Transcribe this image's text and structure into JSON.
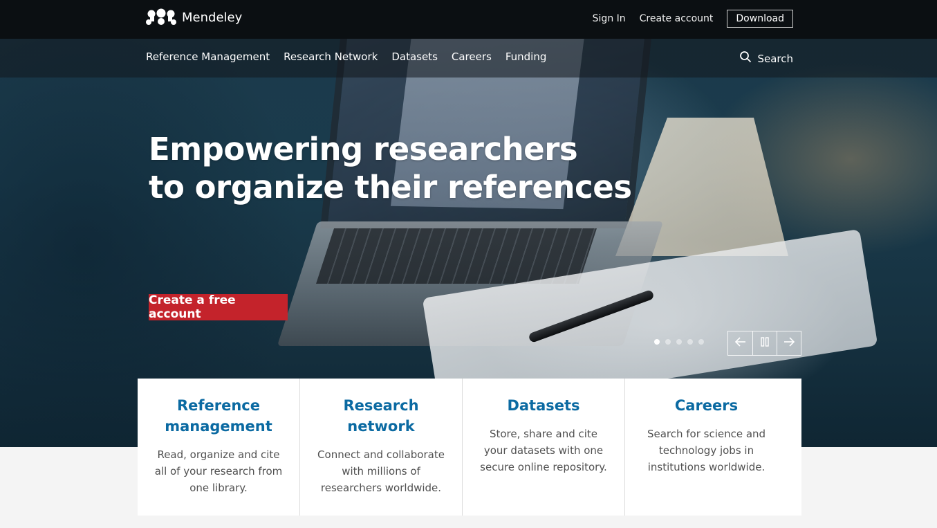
{
  "brand": {
    "name": "Mendeley"
  },
  "topnav": {
    "sign_in": "Sign In",
    "create_account": "Create account",
    "download": "Download"
  },
  "mainnav": {
    "items": [
      "Reference Management",
      "Research Network",
      "Datasets",
      "Careers",
      "Funding"
    ],
    "search_label": "Search"
  },
  "hero": {
    "headline_line1": "Empowering researchers",
    "headline_line2": "to organize their references",
    "cta": "Create a free account",
    "carousel": {
      "slide_count": 5,
      "active_slide": 1
    }
  },
  "cards": [
    {
      "title": "Reference management",
      "text": "Read, organize and cite all of your research from one library."
    },
    {
      "title": "Research network",
      "text": "Connect and collaborate with millions of researchers worldwide."
    },
    {
      "title": "Datasets",
      "text": "Store, share and cite your datasets with one secure online repository."
    },
    {
      "title": "Careers",
      "text": "Search for science and technology jobs in institutions worldwide."
    }
  ],
  "colors": {
    "accent_red": "#c4232b",
    "card_title_blue": "#0b6aa2",
    "topbar_bg": "#0b0f12"
  },
  "icons": [
    "mendeley-logo-icon",
    "search-icon",
    "arrow-left-icon",
    "pause-icon",
    "arrow-right-icon"
  ]
}
